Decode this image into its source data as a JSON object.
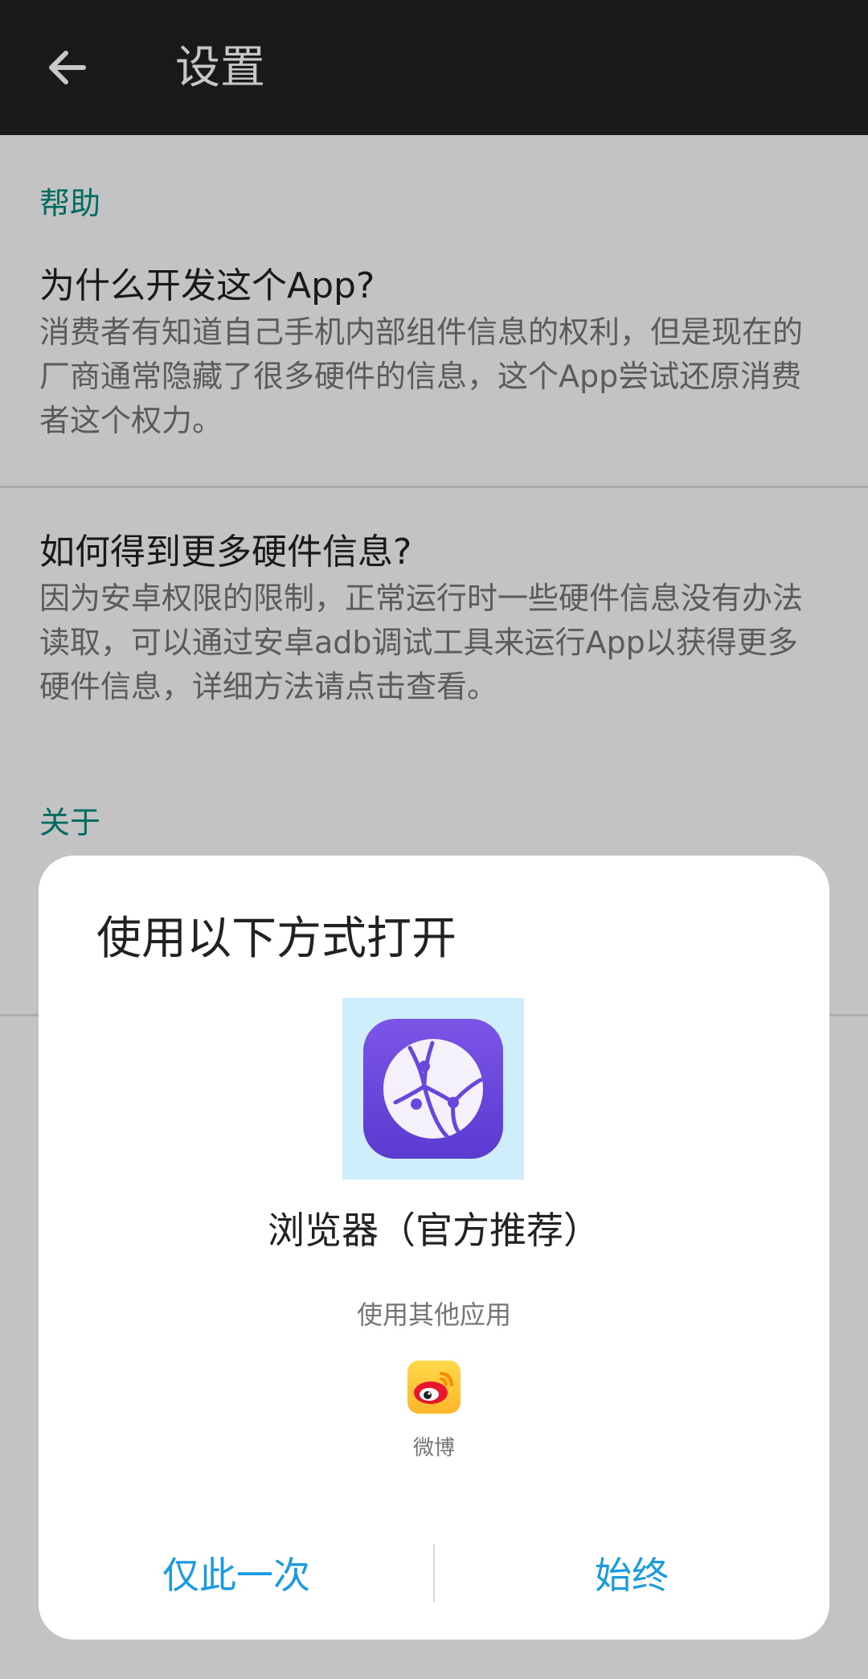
{
  "appbar": {
    "title": "设置"
  },
  "sections": {
    "help_header": "帮助",
    "about_header": "关于"
  },
  "prefs": {
    "why": {
      "title": "为什么开发这个App?",
      "summary": "消费者有知道自己手机内部组件信息的权利，但是现在的厂商通常隐藏了很多硬件的信息，这个App尝试还原消费者这个权力。"
    },
    "more_info": {
      "title": "如何得到更多硬件信息?",
      "summary": "因为安卓权限的限制，正常运行时一些硬件信息没有办法读取，可以通过安卓adb调试工具来运行App以获得更多硬件信息，详细方法请点击查看。"
    }
  },
  "dialog": {
    "title": "使用以下方式打开",
    "primary_app": {
      "name": "浏览器（官方推荐）",
      "icon": "browser-globe-icon"
    },
    "other_apps_label": "使用其他应用",
    "other_apps": [
      {
        "name": "微博",
        "icon": "weibo-icon"
      }
    ],
    "buttons": {
      "once": "仅此一次",
      "always": "始终"
    }
  },
  "colors": {
    "appbar": "#212121",
    "section_header": "#00897b",
    "button_text": "#1a9be0",
    "browser_icon": "#6a47dc"
  }
}
